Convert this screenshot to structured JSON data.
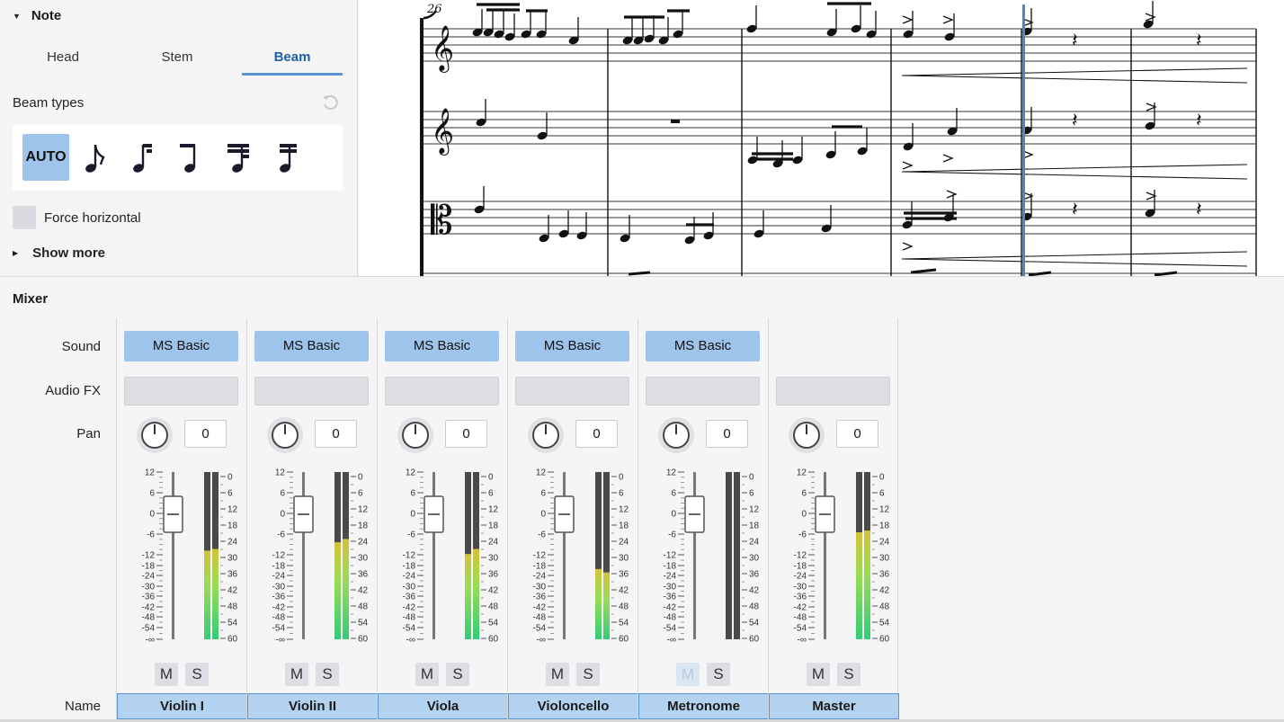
{
  "properties": {
    "section_title": "Note",
    "tabs": [
      {
        "label": "Head",
        "active": false
      },
      {
        "label": "Stem",
        "active": false
      },
      {
        "label": "Beam",
        "active": true
      }
    ],
    "beam_types_label": "Beam types",
    "auto_label": "AUTO",
    "force_horizontal_label": "Force horizontal",
    "show_more_label": "Show more"
  },
  "score": {
    "measure_number": "26"
  },
  "mixer": {
    "title": "Mixer",
    "row_labels": {
      "sound": "Sound",
      "audio_fx": "Audio FX",
      "pan": "Pan",
      "name": "Name"
    },
    "fader_scale": [
      "12",
      "6",
      "0",
      "-6",
      "-12",
      "-18",
      "-24",
      "-30",
      "-36",
      "-42",
      "-48",
      "-54",
      "-∞"
    ],
    "meter_scale": [
      "0",
      "6",
      "12",
      "18",
      "24",
      "30",
      "36",
      "42",
      "48",
      "54",
      "60"
    ],
    "mute_label": "M",
    "solo_label": "S",
    "channels": [
      {
        "name": "Violin I",
        "sound": "MS Basic",
        "pan": "0",
        "meter_left": 0.53,
        "meter_right": 0.54
      },
      {
        "name": "Violin II",
        "sound": "MS Basic",
        "pan": "0",
        "meter_left": 0.58,
        "meter_right": 0.6
      },
      {
        "name": "Viola",
        "sound": "MS Basic",
        "pan": "0",
        "meter_left": 0.51,
        "meter_right": 0.54
      },
      {
        "name": "Violoncello",
        "sound": "MS Basic",
        "pan": "0",
        "meter_left": 0.42,
        "meter_right": 0.4
      },
      {
        "name": "Metronome",
        "sound": "MS Basic",
        "pan": "0",
        "meter_left": 0.0,
        "meter_right": 0.0,
        "mute_disabled": true
      },
      {
        "name": "Master",
        "sound": "",
        "pan": "0",
        "meter_left": 0.64,
        "meter_right": 0.65
      }
    ]
  }
}
